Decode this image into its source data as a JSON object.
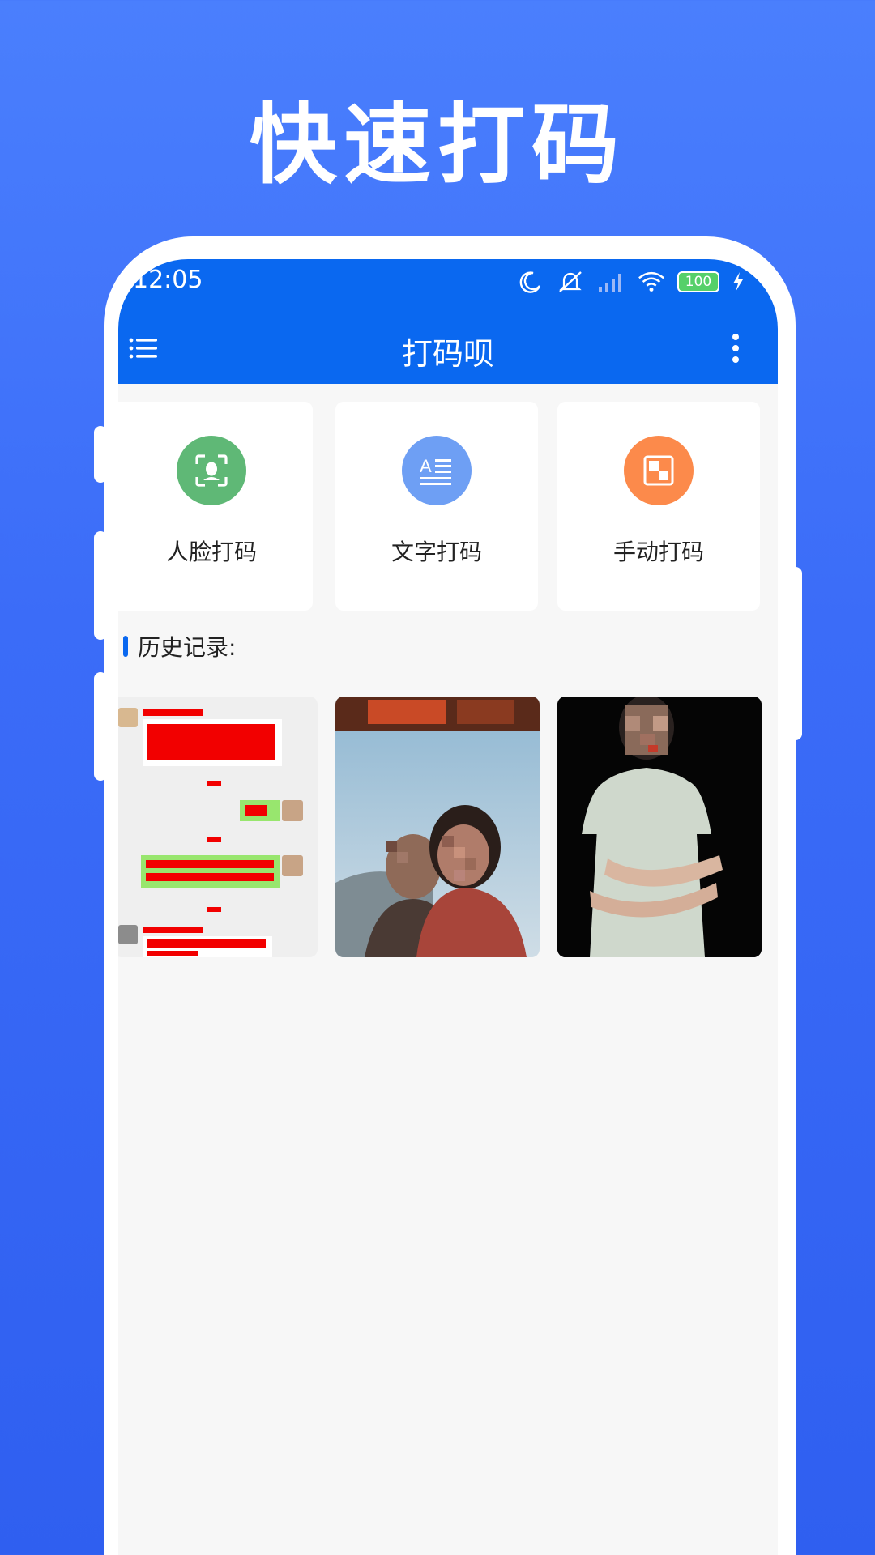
{
  "promo": {
    "title": "快速打码"
  },
  "status": {
    "time": "12:05",
    "battery": "100"
  },
  "app": {
    "title": "打码呗"
  },
  "tools": [
    {
      "label": "人脸打码",
      "icon": "face-scan-icon",
      "color": "#5fb876"
    },
    {
      "label": "文字打码",
      "icon": "text-icon",
      "color": "#6e9ff4"
    },
    {
      "label": "手动打码",
      "icon": "mosaic-icon",
      "color": "#fc8a4b"
    }
  ],
  "history": {
    "title": "历史记录:",
    "items": [
      {
        "kind": "chat-screenshot"
      },
      {
        "kind": "two-girls-photo"
      },
      {
        "kind": "qipao-photo"
      }
    ]
  },
  "colors": {
    "accent": "#0a68f0",
    "background": "#f7f7f7"
  }
}
